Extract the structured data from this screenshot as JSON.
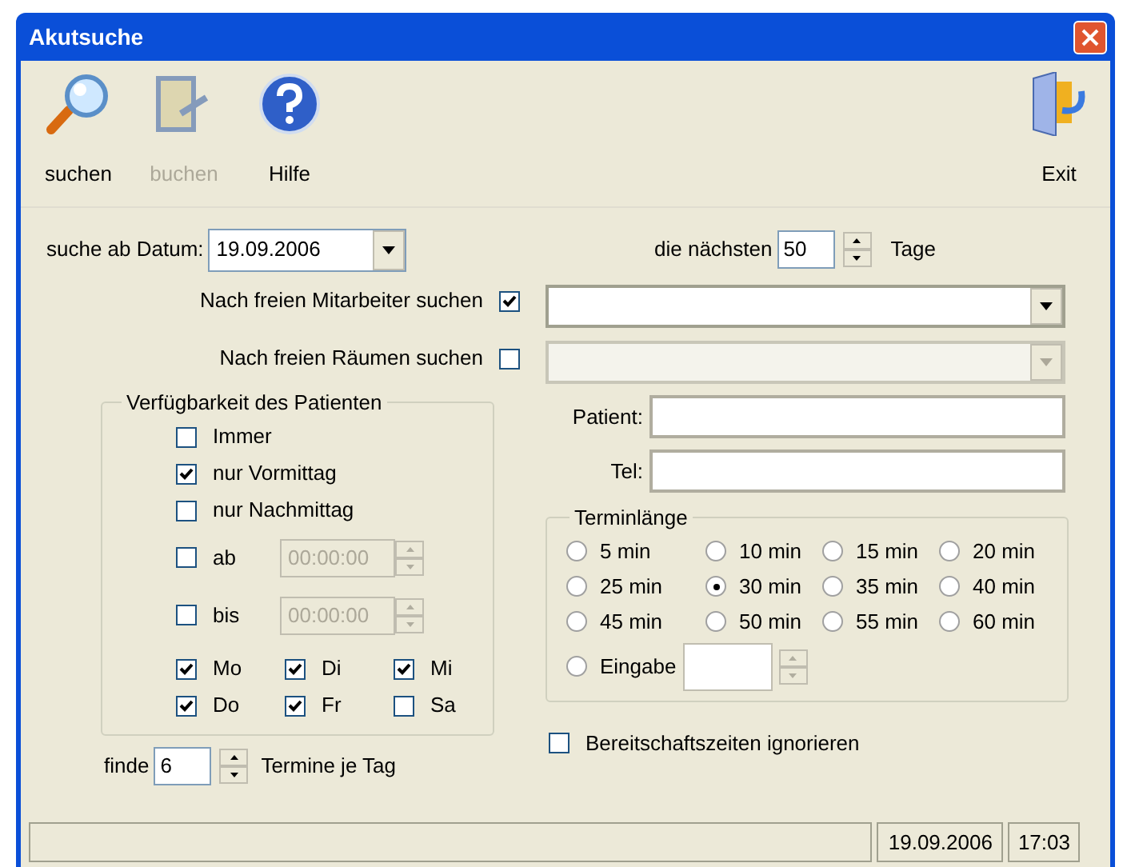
{
  "window": {
    "title": "Akutsuche"
  },
  "toolbar": [
    {
      "label": "suchen",
      "kind": "search",
      "disabled": false
    },
    {
      "label": "buchen",
      "kind": "book",
      "disabled": true
    },
    {
      "label": "Hilfe",
      "kind": "help",
      "disabled": false
    }
  ],
  "exit": {
    "label": "Exit"
  },
  "date": {
    "label": "suche ab Datum:",
    "value": "19.09.2006"
  },
  "next_days": {
    "label": "die nächsten",
    "value": "50",
    "unit": "Tage"
  },
  "search_options": [
    {
      "label": "Nach freien Mitarbeiter suchen",
      "checked": true,
      "combo_disabled": false
    },
    {
      "label": "Nach freien Räumen suchen",
      "checked": false,
      "combo_disabled": true
    }
  ],
  "availability": {
    "title": "Verfügbarkeit des Patienten",
    "options": [
      {
        "label": "Immer",
        "checked": false,
        "kind": "plain"
      },
      {
        "label": "nur Vormittag",
        "checked": true,
        "kind": "plain"
      },
      {
        "label": "nur Nachmittag",
        "checked": false,
        "kind": "plain"
      },
      {
        "label": "ab",
        "checked": false,
        "kind": "time",
        "time": "00:00:00"
      },
      {
        "label": "bis",
        "checked": false,
        "kind": "time",
        "time": "00:00:00"
      }
    ],
    "days": [
      {
        "label": "Mo",
        "checked": true
      },
      {
        "label": "Di",
        "checked": true
      },
      {
        "label": "Mi",
        "checked": true
      },
      {
        "label": "Do",
        "checked": true
      },
      {
        "label": "Fr",
        "checked": true
      },
      {
        "label": "Sa",
        "checked": false
      }
    ]
  },
  "finde": {
    "label": "finde",
    "value": "6",
    "suffix": "Termine je Tag"
  },
  "patient": {
    "label": "Patient:"
  },
  "tel": {
    "label": "Tel:"
  },
  "duration": {
    "title": "Terminlänge",
    "options": [
      {
        "label": "5 min",
        "selected": false
      },
      {
        "label": "10 min",
        "selected": false
      },
      {
        "label": "15 min",
        "selected": false
      },
      {
        "label": "20 min",
        "selected": false
      },
      {
        "label": "25 min",
        "selected": false
      },
      {
        "label": "30 min",
        "selected": true
      },
      {
        "label": "35 min",
        "selected": false
      },
      {
        "label": "40 min",
        "selected": false
      },
      {
        "label": "45 min",
        "selected": false
      },
      {
        "label": "50 min",
        "selected": false
      },
      {
        "label": "55 min",
        "selected": false
      },
      {
        "label": "60 min",
        "selected": false
      }
    ],
    "custom": {
      "label": "Eingabe",
      "selected": false
    }
  },
  "ignore_standby": {
    "label": "Bereitschaftszeiten ignorieren",
    "checked": false
  },
  "status_bar": {
    "date": "19.09.2006",
    "time": "17:03"
  }
}
